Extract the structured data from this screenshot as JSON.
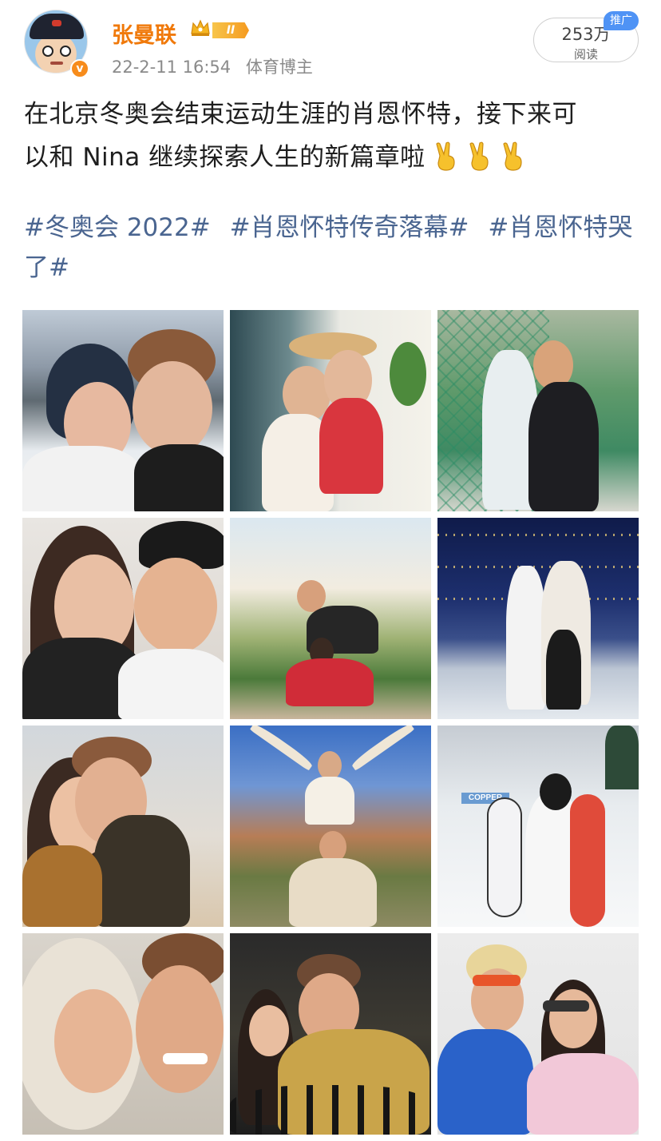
{
  "post": {
    "username": "张曼联",
    "level_badge": "II",
    "timestamp": "22-2-11 16:54",
    "category": "体育博主",
    "views_count": "253万",
    "views_label": "阅读",
    "promo_tag": "推广",
    "text_line1": "在北京冬奥会结束运动生涯的肖恩怀特，接下来可",
    "text_line2": "以和 Nina 继续探索人生的新篇章啦",
    "hashtags": [
      "#冬奥会 2022#",
      "#肖恩怀特传奇落幕#",
      "#肖恩怀特哭了#"
    ]
  },
  "icons": {
    "avatar": "cartoon-boy-avatar",
    "verified": "orange-verified-icon",
    "crown": "vip-crown-icon",
    "emoji": "victory-hand-emoji"
  },
  "colors": {
    "username": "#f0790a",
    "hashtag": "#4a6590",
    "promo": "#4f93f5",
    "meta": "#8a8a8a"
  },
  "photos": [
    "selfie-snow-mountain",
    "couple-straw-hat-patio",
    "kiss-through-net",
    "closeup-selfie-beanie",
    "piggyback-garden",
    "night-lights-curling",
    "beach-selfie-sunglasses",
    "arms-up-canyon",
    "snowboards-copper",
    "fur-hood-laughing",
    "hockey-arena-jersey",
    "retro-costume-sunglasses"
  ],
  "photo_text": {
    "copper_sign": "COPPER"
  }
}
